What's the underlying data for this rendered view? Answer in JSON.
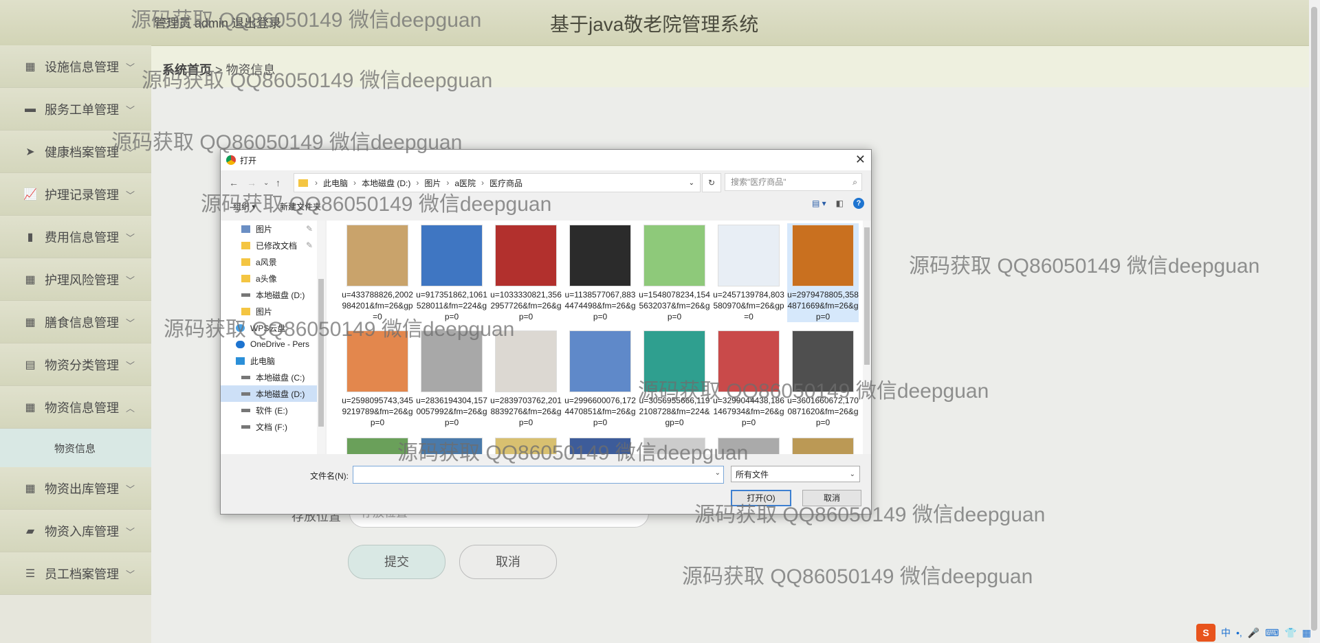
{
  "header": {
    "admin_text": "管理员 admin  退出登录",
    "system_title": "基于java敬老院管理系统"
  },
  "sidebar": {
    "items": [
      {
        "label": "设施信息管理",
        "icon": "grid-icon"
      },
      {
        "label": "服务工单管理",
        "icon": "monitor-icon"
      },
      {
        "label": "健康档案管理",
        "icon": "send-icon"
      },
      {
        "label": "护理记录管理",
        "icon": "chart-icon"
      },
      {
        "label": "费用信息管理",
        "icon": "book-icon"
      },
      {
        "label": "护理风险管理",
        "icon": "grid-icon"
      },
      {
        "label": "膳食信息管理",
        "icon": "grid-icon"
      },
      {
        "label": "物资分类管理",
        "icon": "clipboard-icon"
      },
      {
        "label": "物资信息管理",
        "icon": "grid-icon"
      },
      {
        "label": "物资出库管理",
        "icon": "grid-icon"
      },
      {
        "label": "物资入库管理",
        "icon": "briefcase-icon"
      },
      {
        "label": "员工档案管理",
        "icon": "sliders-icon"
      }
    ],
    "sub_item": "物资信息"
  },
  "breadcrumb": {
    "home": "系统首页",
    "separator": ">",
    "current": "物资信息"
  },
  "form": {
    "location_label": "存放位置",
    "location_placeholder": "存放位置",
    "submit_label": "提交",
    "cancel_label": "取消"
  },
  "dialog": {
    "title": "打开",
    "path": [
      "此电脑",
      "本地磁盘 (D:)",
      "图片",
      "a医院",
      "医疗商品"
    ],
    "search_placeholder": "搜索\"医疗商品\"",
    "organize_label": "组织 ▾",
    "new_folder_label": "新建文件夹",
    "tree": [
      {
        "label": "图片",
        "icon": "picture-folder-icon"
      },
      {
        "label": "已修改文档",
        "icon": "folder-icon"
      },
      {
        "label": "a风景",
        "icon": "folder-icon"
      },
      {
        "label": "a头像",
        "icon": "folder-icon"
      },
      {
        "label": "本地磁盘 (D:)",
        "icon": "drive-icon"
      },
      {
        "label": "图片",
        "icon": "folder-icon"
      },
      {
        "label": "WPS云盘",
        "icon": "cloud-icon"
      },
      {
        "label": "OneDrive - Pers",
        "icon": "cloud-icon"
      },
      {
        "label": "此电脑",
        "icon": "computer-icon"
      },
      {
        "label": "本地磁盘 (C:)",
        "icon": "drive-icon"
      },
      {
        "label": "本地磁盘 (D:)",
        "icon": "drive-icon"
      },
      {
        "label": "软件 (E:)",
        "icon": "drive-icon"
      },
      {
        "label": "文档 (F:)",
        "icon": "drive-icon"
      }
    ],
    "files": [
      {
        "name": "u=433788826,2002984201&fm=26&gp=0",
        "color": "#c9a36b"
      },
      {
        "name": "u=917351862,1061528011&fm=224&gp=0",
        "color": "#3f76c2"
      },
      {
        "name": "u=1033330821,3562957726&fm=26&gp=0",
        "color": "#b2302d"
      },
      {
        "name": "u=1138577067,8834474498&fm=26&gp=0",
        "color": "#2b2b2b"
      },
      {
        "name": "u=1548078234,1545632037&fm=26&gp=0",
        "color": "#8ec97a"
      },
      {
        "name": "u=2457139784,803580970&fm=26&gp=0",
        "color": "#e8eef5"
      },
      {
        "name": "u=2979478805,3584871669&fm=26&gp=0",
        "color": "#c9701f"
      },
      {
        "name": "u=2598095743,3459219789&fm=26&gp=0",
        "color": "#e3874d"
      },
      {
        "name": "u=2836194304,1570057992&fm=26&gp=0",
        "color": "#a8a8a8"
      },
      {
        "name": "u=2839703762,2018839276&fm=26&gp=0",
        "color": "#dcd8d2"
      },
      {
        "name": "u=2996600076,1724470851&fm=26&gp=0",
        "color": "#5f89c9"
      },
      {
        "name": "u=3056955666,1192108728&fm=224&gp=0",
        "color": "#2f9f8f"
      },
      {
        "name": "u=3299044438,1861467934&fm=26&gp=0",
        "color": "#c94a4a"
      },
      {
        "name": "u=3601660672,1700871620&fm=26&gp=0",
        "color": "#4f4f4f"
      }
    ],
    "filename_label": "文件名(N):",
    "filetype_label": "所有文件",
    "open_label": "打开(O)",
    "cancel_label": "取消"
  },
  "watermark": "源码获取 QQ86050149 微信deepguan",
  "tray": {
    "ime_label": "中"
  }
}
